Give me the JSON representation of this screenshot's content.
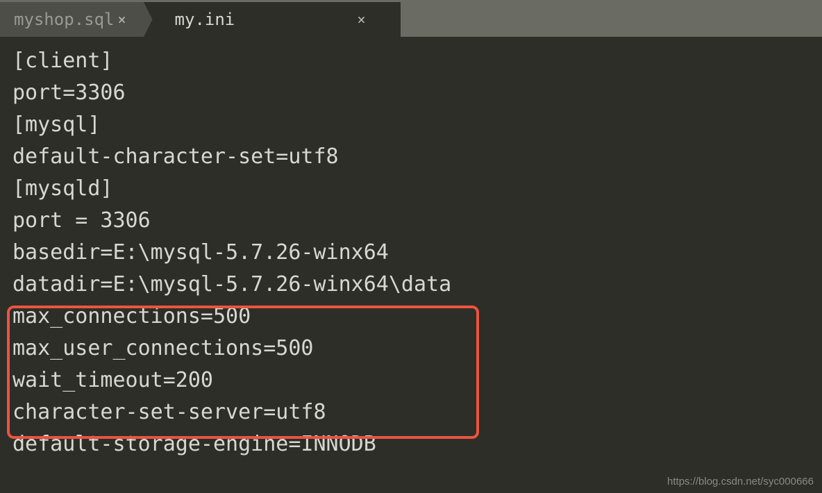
{
  "tabs": [
    {
      "label": "myshop.sql",
      "active": false
    },
    {
      "label": "my.ini",
      "active": true
    }
  ],
  "code_lines": [
    "[client]",
    "port=3306",
    "[mysql]",
    "default-character-set=utf8",
    "[mysqld]",
    "port = 3306",
    "basedir=E:\\mysql-5.7.26-winx64",
    "datadir=E:\\mysql-5.7.26-winx64\\data",
    "max_connections=500",
    "max_user_connections=500",
    "wait_timeout=200",
    "character-set-server=utf8",
    "default-storage-engine=INNODB"
  ],
  "close_glyph": "×",
  "watermark": "https://blog.csdn.net/syc000666"
}
